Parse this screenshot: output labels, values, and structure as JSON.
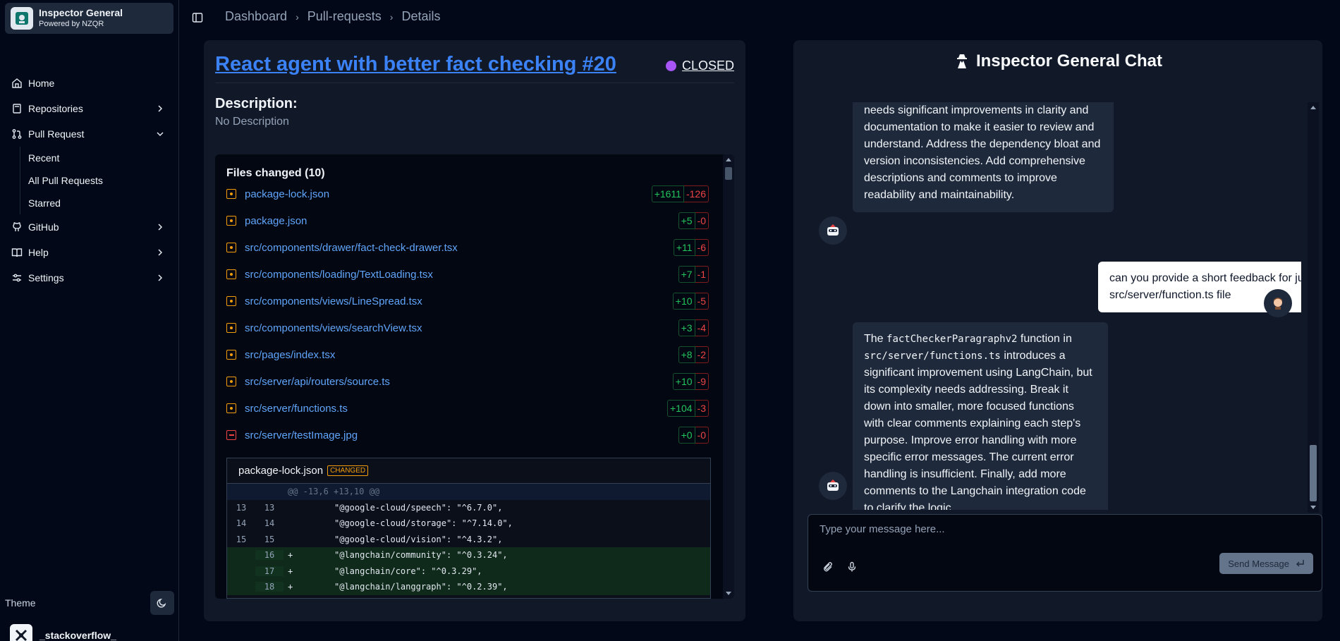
{
  "brand": {
    "title": "Inspector General",
    "subtitle": "Powered by NZQR"
  },
  "nav": {
    "home": "Home",
    "repositories": "Repositories",
    "pull_request": "Pull Request",
    "pr_sub": [
      "Recent",
      "All Pull Requests",
      "Starred"
    ],
    "github": "GitHub",
    "help": "Help",
    "settings": "Settings"
  },
  "sidebar_footer": {
    "theme": "Theme",
    "user": "_stackoverflow_"
  },
  "breadcrumb": [
    "Dashboard",
    "Pull-requests",
    "Details"
  ],
  "pr": {
    "title": "React agent with better fact checking #20",
    "status": "CLOSED",
    "status_color": "#a855f7",
    "description_heading": "Description:",
    "description": "No Description"
  },
  "files": {
    "heading": "Files changed (10)",
    "items": [
      {
        "name": "package-lock.json",
        "add": "+1611",
        "rem": "-126",
        "kind": "changed"
      },
      {
        "name": "package.json",
        "add": "+5",
        "rem": "-0",
        "kind": "changed"
      },
      {
        "name": "src/components/drawer/fact-check-drawer.tsx",
        "add": "+11",
        "rem": "-6",
        "kind": "changed"
      },
      {
        "name": "src/components/loading/TextLoading.tsx",
        "add": "+7",
        "rem": "-1",
        "kind": "changed"
      },
      {
        "name": "src/components/views/LineSpread.tsx",
        "add": "+10",
        "rem": "-5",
        "kind": "changed"
      },
      {
        "name": "src/components/views/searchView.tsx",
        "add": "+3",
        "rem": "-4",
        "kind": "changed"
      },
      {
        "name": "src/pages/index.tsx",
        "add": "+8",
        "rem": "-2",
        "kind": "changed"
      },
      {
        "name": "src/server/api/routers/source.ts",
        "add": "+10",
        "rem": "-9",
        "kind": "changed"
      },
      {
        "name": "src/server/functions.ts",
        "add": "+104",
        "rem": "-3",
        "kind": "changed"
      },
      {
        "name": "src/server/testImage.jpg",
        "add": "+0",
        "rem": "-0",
        "kind": "deleted"
      }
    ]
  },
  "diff": {
    "file": "package-lock.json",
    "badge": "CHANGED",
    "hunk": "@@ -13,6 +13,10 @@",
    "lines": [
      {
        "o": "13",
        "n": "13",
        "m": "",
        "code": "\"@google-cloud/speech\": \"^6.7.0\",",
        "type": "ctx"
      },
      {
        "o": "14",
        "n": "14",
        "m": "",
        "code": "\"@google-cloud/storage\": \"^7.14.0\",",
        "type": "ctx"
      },
      {
        "o": "15",
        "n": "15",
        "m": "",
        "code": "\"@google-cloud/vision\": \"^4.3.2\",",
        "type": "ctx"
      },
      {
        "o": "",
        "n": "16",
        "m": "+",
        "code": "\"@langchain/community\": \"^0.3.24\",",
        "type": "plus"
      },
      {
        "o": "",
        "n": "17",
        "m": "+",
        "code": "\"@langchain/core\": \"^0.3.29\",",
        "type": "plus"
      },
      {
        "o": "",
        "n": "18",
        "m": "+",
        "code": "\"@langchain/langgraph\": \"^0.2.39\",",
        "type": "plus"
      }
    ]
  },
  "chat": {
    "title": "Inspector General Chat",
    "msg1": "needs significant improvements in clarity and documentation to make it easier to review and understand. Address the dependency bloat and version inconsistencies. Add comprehensive descriptions and comments to improve readability and maintainability.",
    "msg2": "can you provide a short feedback for just src/server/function.ts file",
    "msg3_pre": "The ",
    "msg3_code1": "factCheckerParagraphv2",
    "msg3_mid": " function in ",
    "msg3_code2": "src/server/functions.ts",
    "msg3_post": " introduces a significant improvement using LangChain, but its complexity needs addressing.  Break it down into smaller, more focused functions with clear comments explaining each step's purpose.  Improve error handling with more specific error messages.  The current error handling is insufficient.  Finally, add more comments to the Langchain integration code to clarify the logic.",
    "placeholder": "Type your message here...",
    "send_label": "Send Message"
  }
}
